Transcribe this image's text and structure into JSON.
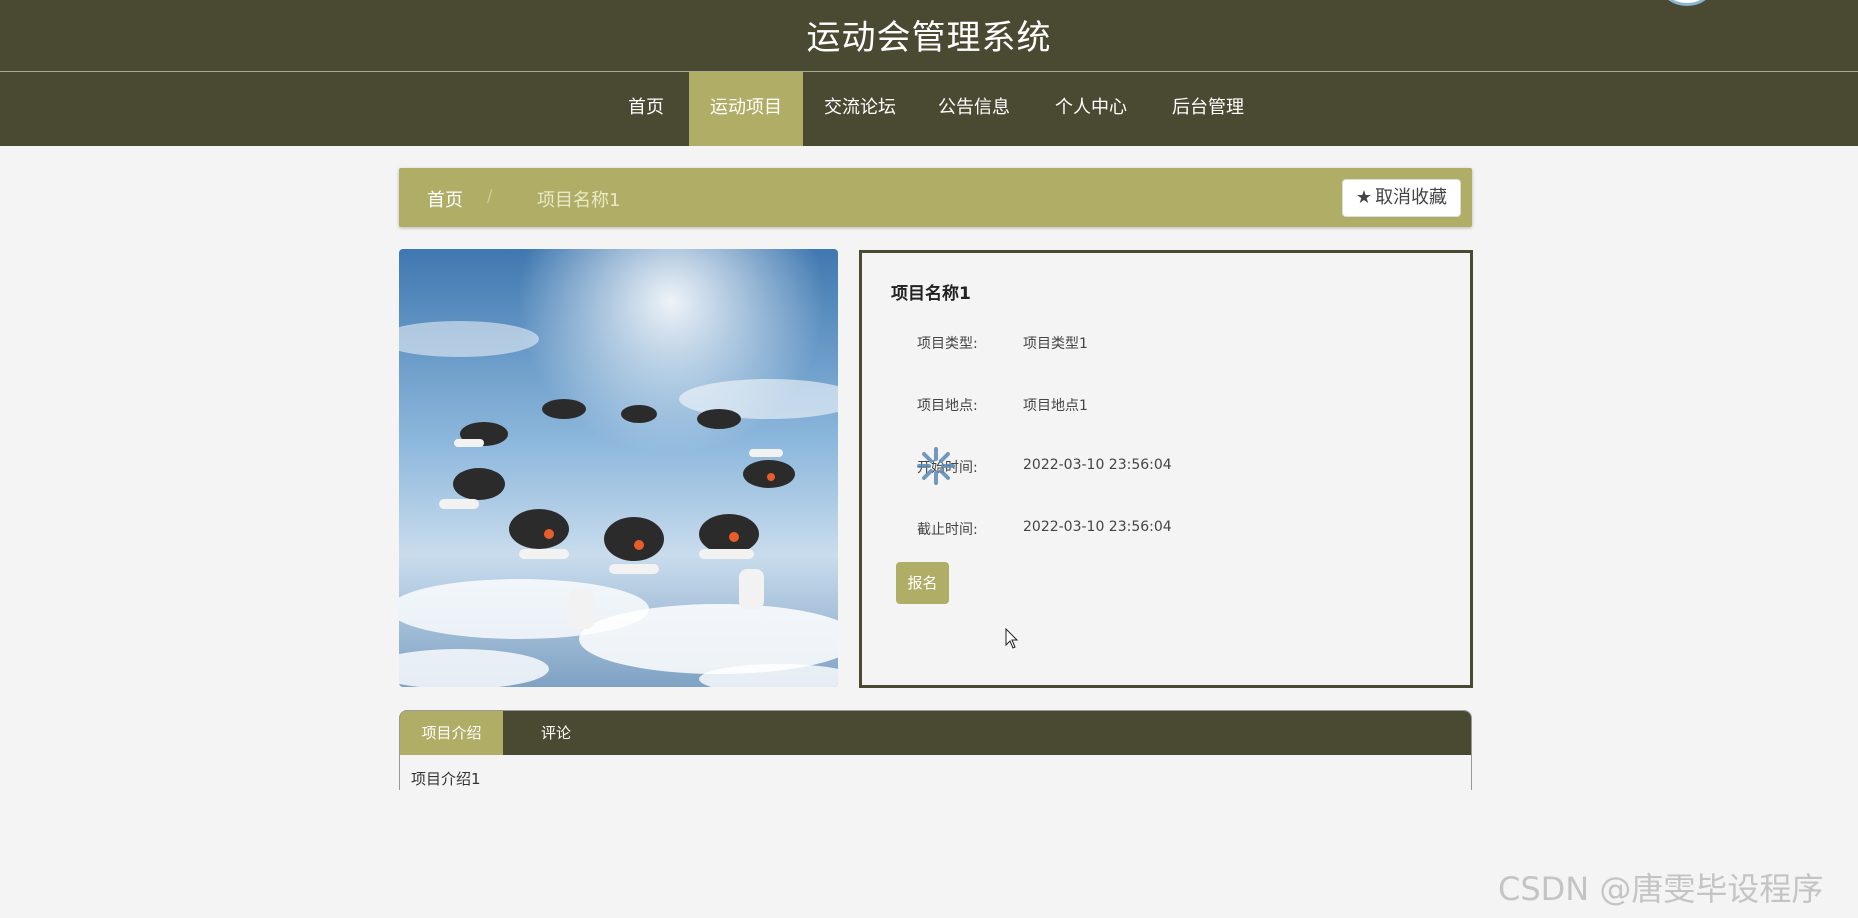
{
  "header": {
    "title": "运动会管理系统"
  },
  "nav": {
    "items": [
      {
        "label": "首页"
      },
      {
        "label": "运动项目"
      },
      {
        "label": "交流论坛"
      },
      {
        "label": "公告信息"
      },
      {
        "label": "个人中心"
      },
      {
        "label": "后台管理"
      }
    ],
    "active_index": 1
  },
  "breadcrumb": {
    "home": "首页",
    "separator": "/",
    "current": "项目名称1"
  },
  "favorite_button": {
    "label": "取消收藏",
    "icon": "star-icon"
  },
  "project": {
    "name": "项目名称1",
    "fields": [
      {
        "label": "项目类型:",
        "value": "项目类型1"
      },
      {
        "label": "项目地点:",
        "value": "项目地点1"
      },
      {
        "label": "开始时间:",
        "value": "2022-03-10 23:56:04"
      },
      {
        "label": "截止时间:",
        "value": "2022-03-10 23:56:04"
      }
    ],
    "signup_label": "报名"
  },
  "tabs": {
    "items": [
      {
        "label": "项目介绍"
      },
      {
        "label": "评论"
      }
    ],
    "active_index": 0,
    "content": "项目介绍1"
  },
  "watermark": "CSDN @唐雯毕设程序",
  "colors": {
    "header_bg": "#4a4a33",
    "accent": "#b0ae66",
    "page_bg": "#f4f4f4"
  }
}
